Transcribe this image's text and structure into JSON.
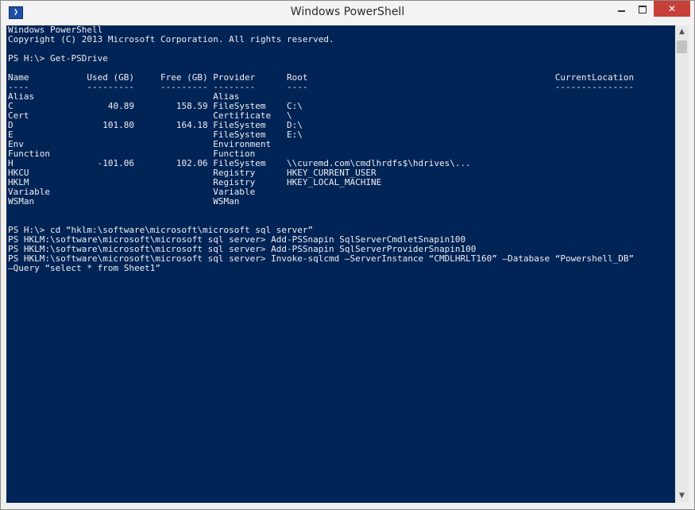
{
  "window": {
    "title": "Windows PowerShell",
    "icon": "powershell-icon",
    "icon_glyph": "❯",
    "controls": {
      "minimize": "minimize-icon",
      "maximize": "maximize-icon",
      "close": "close-icon",
      "close_glyph": "✕"
    }
  },
  "colors": {
    "console_background": "#012456",
    "console_text": "#eeedf0",
    "close_button": "#c7403a"
  },
  "scrollbar": {
    "up_glyph": "▲",
    "down_glyph": "▼"
  },
  "console": {
    "lines": [
      "Windows PowerShell",
      "Copyright (C) 2013 Microsoft Corporation. All rights reserved.",
      "",
      "PS H:\\> Get-PSDrive",
      "",
      "Name           Used (GB)     Free (GB) Provider      Root                                               CurrentLocation",
      "----           ---------     --------- --------      ----                                               ---------------",
      "Alias                                  Alias",
      "C                  40.89        158.59 FileSystem    C:\\",
      "Cert                                   Certificate   \\",
      "D                 101.80        164.18 FileSystem    D:\\",
      "E                                      FileSystem    E:\\",
      "Env                                    Environment",
      "Function                               Function",
      "H                -101.06        102.06 FileSystem    \\\\curemd.com\\cmdlhrdfs$\\hdrives\\...",
      "HKCU                                   Registry      HKEY_CURRENT_USER",
      "HKLM                                   Registry      HKEY_LOCAL_MACHINE",
      "Variable                               Variable",
      "WSMan                                  WSMan",
      "",
      "",
      "PS H:\\> cd “hklm:\\software\\microsoft\\microsoft sql server”",
      "PS HKLM:\\software\\microsoft\\microsoft sql server> Add-PSSnapin SqlServerCmdletSnapin100",
      "PS HKLM:\\software\\microsoft\\microsoft sql server> Add-PSSnapin SqlServerProviderSnapin100",
      "PS HKLM:\\software\\microsoft\\microsoft sql server> Invoke-sqlcmd –ServerInstance “CMDLHRLT160” –Database “Powershell_DB”",
      "–Query “select * from Sheet1”"
    ]
  }
}
